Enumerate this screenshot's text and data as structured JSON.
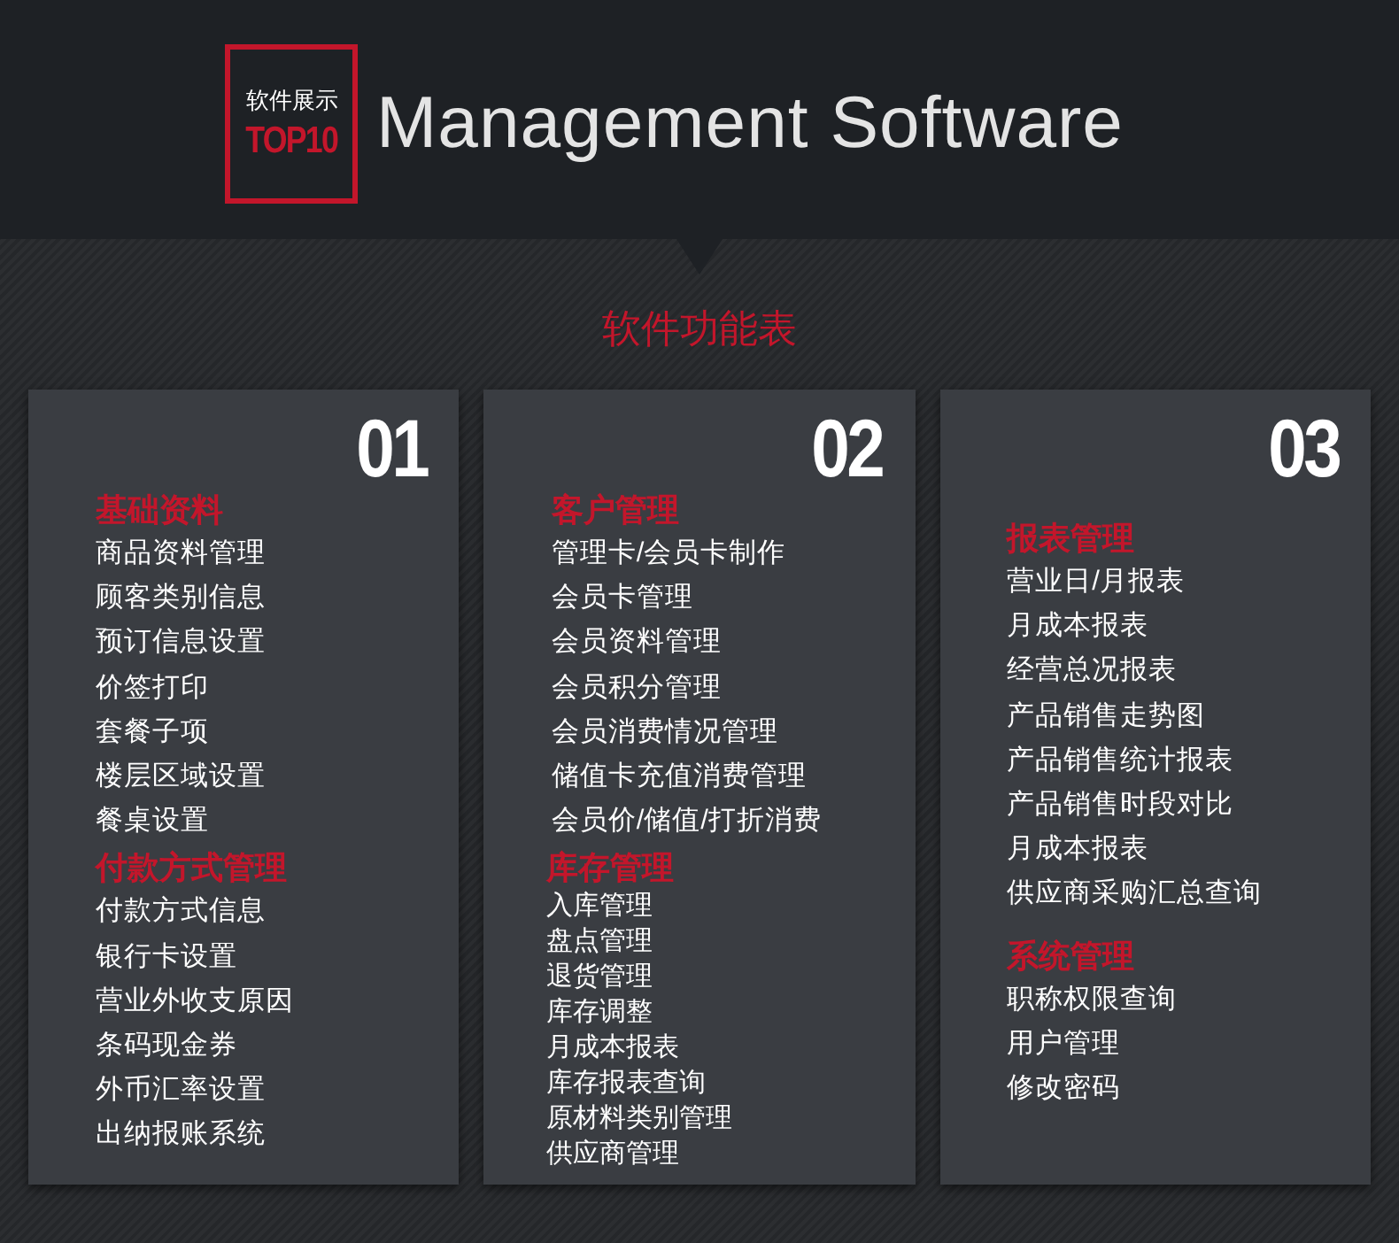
{
  "header": {
    "badge": {
      "caption": "软件展示",
      "label": "TOP10"
    },
    "title": "Management Software"
  },
  "section_title": "软件功能表",
  "cards": [
    {
      "number": "01",
      "groups": [
        {
          "heading": "基础资料",
          "kind": "spaced",
          "items": [
            "商品资料管理",
            "顾客类别信息",
            "预订信息设置",
            "价签打印",
            "套餐子项",
            "楼层区域设置",
            "餐桌设置"
          ]
        },
        {
          "heading": "付款方式管理",
          "kind": "spaced",
          "items": [
            "付款方式信息",
            "银行卡设置",
            "营业外收支原因",
            "条码现金券",
            "外币汇率设置",
            "出纳报账系统"
          ]
        }
      ]
    },
    {
      "number": "02",
      "groups": [
        {
          "heading": "客户管理",
          "kind": "spaced",
          "items": [
            "管理卡/会员卡制作",
            "会员卡管理",
            "会员资料管理",
            "会员积分管理",
            "会员消费情况管理",
            "储值卡充值消费管理",
            "会员价/储值/打折消费"
          ]
        },
        {
          "heading": "库存管理",
          "kind": "compact",
          "items": [
            "入库管理",
            "盘点管理",
            "退货管理",
            "库存调整",
            "月成本报表",
            "库存报表查询",
            "原材料类别管理",
            "供应商管理"
          ]
        }
      ]
    },
    {
      "number": "03",
      "groups": [
        {
          "heading": "报表管理",
          "kind": "spaced",
          "items": [
            "营业日/月报表",
            "月成本报表",
            "经营总况报表",
            "产品销售走势图",
            "产品销售统计报表",
            "产品销售时段对比",
            "月成本报表",
            "供应商采购汇总查询"
          ]
        },
        {
          "heading": "系统管理",
          "kind": "spaced",
          "items": [
            "职称权限查询",
            "用户管理",
            "修改密码"
          ]
        }
      ]
    }
  ]
}
